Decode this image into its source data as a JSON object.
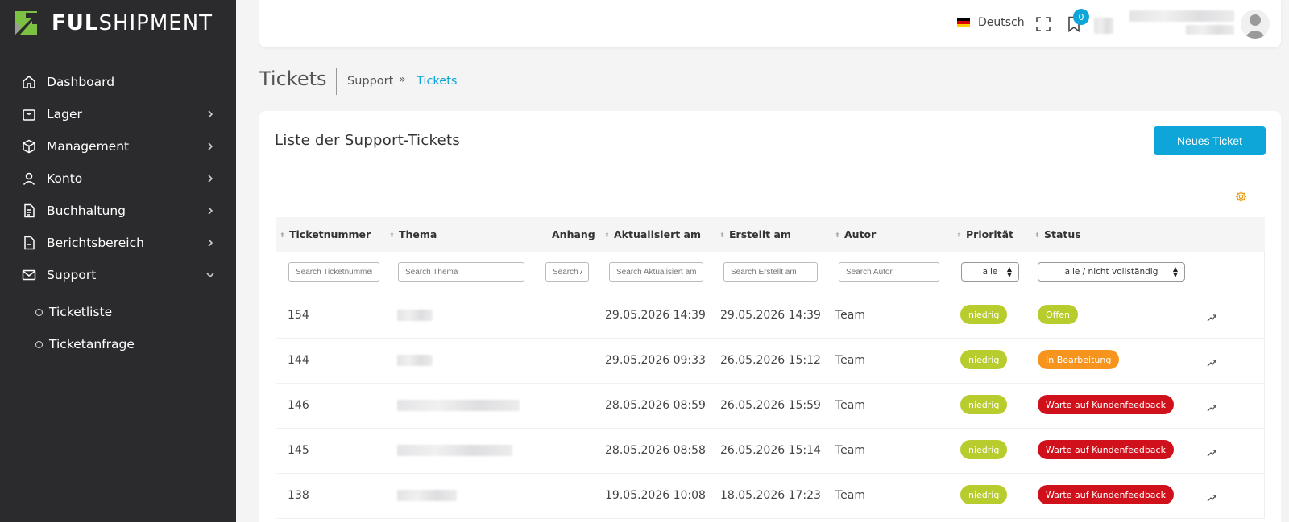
{
  "app": {
    "logo_bold": "FUL",
    "logo_light": "SHIPMENT",
    "logo_colors": {
      "green": "#7cc142",
      "gray": "#aaaaaa"
    }
  },
  "sidebar": {
    "items": [
      {
        "label": "Dashboard",
        "icon": "home-icon",
        "has_chevron": false
      },
      {
        "label": "Lager",
        "icon": "bag-icon",
        "has_chevron": true
      },
      {
        "label": "Management",
        "icon": "cube-icon",
        "has_chevron": true
      },
      {
        "label": "Konto",
        "icon": "user-icon",
        "has_chevron": true
      },
      {
        "label": "Buchhaltung",
        "icon": "document-icon",
        "has_chevron": true
      },
      {
        "label": "Berichtsbereich",
        "icon": "report-icon",
        "has_chevron": true
      },
      {
        "label": "Support",
        "icon": "mail-icon",
        "has_chevron": true,
        "expanded": true
      }
    ],
    "sub_items": [
      {
        "label": "Ticketliste"
      },
      {
        "label": "Ticketanfrage"
      }
    ]
  },
  "header": {
    "language": "Deutsch",
    "bookmark_count": "0"
  },
  "page": {
    "title": "Tickets",
    "breadcrumb": [
      "Support",
      "Tickets"
    ],
    "breadcrumb_separator": "»"
  },
  "card": {
    "title": "Liste der Support-Tickets",
    "new_button": "Neues Ticket"
  },
  "table": {
    "columns": [
      "Ticketnummer",
      "Thema",
      "Anhang",
      "Aktualisiert am",
      "Erstellt am",
      "Autor",
      "Priorität",
      "Status"
    ],
    "filters": {
      "ticketnummer": "Search Ticketnummer",
      "thema": "Search Thema",
      "anhang": "Search Anhang",
      "aktualisiert": "Search Aktualisiert am",
      "erstellt": "Search Erstellt am",
      "autor": "Search Autor",
      "prioritaet": "alle",
      "status": "alle / nicht vollständig"
    },
    "rows": [
      {
        "nr": "154",
        "aktualisiert": "29.05.2026 14:39",
        "erstellt": "29.05.2026 14:39",
        "autor": "Team",
        "prioritaet": "niedrig",
        "status": "Offen",
        "status_color": "#b8cc2e"
      },
      {
        "nr": "144",
        "aktualisiert": "29.05.2026 09:33",
        "erstellt": "26.05.2026 15:12",
        "autor": "Team",
        "prioritaet": "niedrig",
        "status": "In Bearbeitung",
        "status_color": "#f7941d"
      },
      {
        "nr": "146",
        "aktualisiert": "28.05.2026 08:59",
        "erstellt": "26.05.2026 15:59",
        "autor": "Team",
        "prioritaet": "niedrig",
        "status": "Warte auf Kundenfeedback",
        "status_color": "#d0111b"
      },
      {
        "nr": "145",
        "aktualisiert": "28.05.2026 08:58",
        "erstellt": "26.05.2026 15:14",
        "autor": "Team",
        "prioritaet": "niedrig",
        "status": "Warte auf Kundenfeedback",
        "status_color": "#d0111b"
      },
      {
        "nr": "138",
        "aktualisiert": "19.05.2026 10:08",
        "erstellt": "18.05.2026 17:23",
        "autor": "Team",
        "prioritaet": "niedrig",
        "status": "Warte auf Kundenfeedback",
        "status_color": "#d0111b"
      }
    ],
    "priority_color": "#b8cc2e",
    "accent_color": "#0ea5d9"
  }
}
